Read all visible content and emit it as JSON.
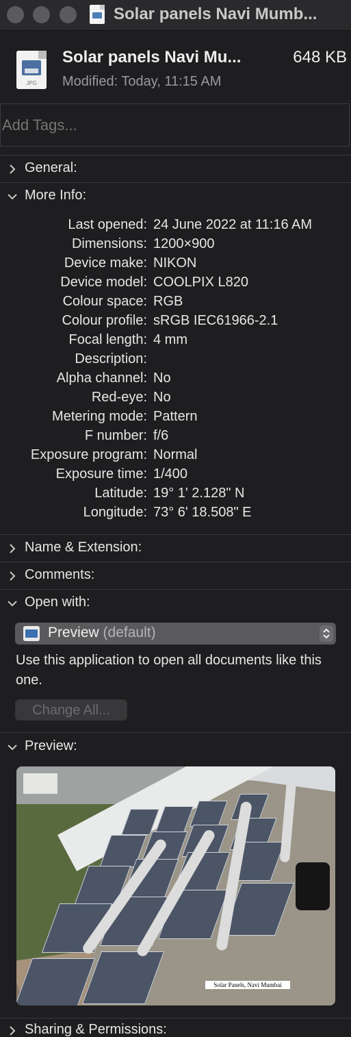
{
  "window": {
    "title": "Solar panels Navi Mumb..."
  },
  "header": {
    "file_name": "Solar panels Navi Mu...",
    "file_size": "648 KB",
    "modified": "Modified: Today, 11:15 AM",
    "file_ext": "JPG",
    "icon": "jpg-file-icon"
  },
  "tags": {
    "placeholder": "Add Tags..."
  },
  "sections": {
    "general": "General:",
    "more_info": "More Info:",
    "name_extension": "Name & Extension:",
    "comments": "Comments:",
    "open_with": "Open with:",
    "preview": "Preview:",
    "sharing": "Sharing & Permissions:"
  },
  "more_info": [
    {
      "key": "Last opened:",
      "value": "24 June 2022 at 11:16 AM"
    },
    {
      "key": "Dimensions:",
      "value": "1200×900"
    },
    {
      "key": "Device make:",
      "value": "NIKON"
    },
    {
      "key": "Device model:",
      "value": "COOLPIX L820"
    },
    {
      "key": "Colour space:",
      "value": "RGB"
    },
    {
      "key": "Colour profile:",
      "value": "sRGB IEC61966-2.1"
    },
    {
      "key": "Focal length:",
      "value": "4 mm"
    },
    {
      "key": "Description:",
      "value": ""
    },
    {
      "key": "Alpha channel:",
      "value": "No"
    },
    {
      "key": "Red-eye:",
      "value": "No"
    },
    {
      "key": "Metering mode:",
      "value": "Pattern"
    },
    {
      "key": "F number:",
      "value": "f/6"
    },
    {
      "key": "Exposure program:",
      "value": "Normal"
    },
    {
      "key": "Exposure time:",
      "value": "1/400"
    },
    {
      "key": "Latitude:",
      "value": "19° 1' 2.128\" N"
    },
    {
      "key": "Longitude:",
      "value": "73° 6' 18.508\" E"
    }
  ],
  "open_with": {
    "app_name": "Preview",
    "app_default": "(default)",
    "description": "Use this application to open all documents like this one.",
    "change_all_label": "Change All..."
  },
  "preview": {
    "caption": "Solar Panels, Navi Mumbai"
  },
  "colors": {
    "background": "#1e1e20",
    "text": "#e6e6e6",
    "secondary_text": "#9a9a9c",
    "popup": "#5a5a5d"
  }
}
